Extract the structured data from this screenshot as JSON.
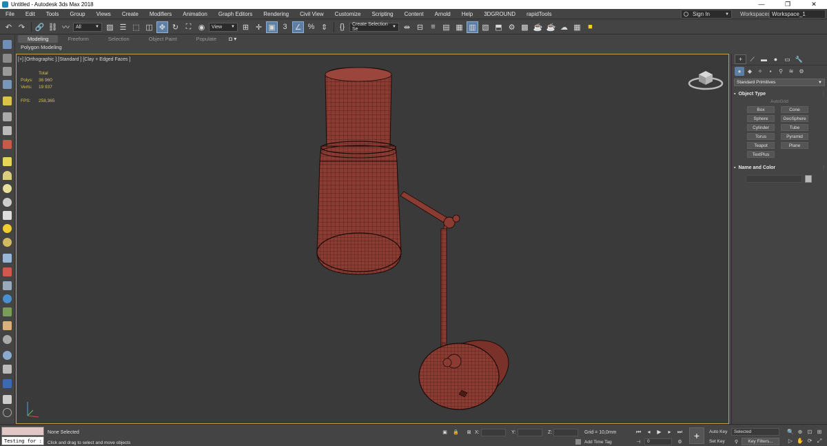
{
  "window": {
    "title": "Untitled - Autodesk 3ds Max 2018",
    "min": "—",
    "max": "❐",
    "close": "✕"
  },
  "menu": {
    "items": [
      "File",
      "Edit",
      "Tools",
      "Group",
      "Views",
      "Create",
      "Modifiers",
      "Animation",
      "Graph Editors",
      "Rendering",
      "Civil View",
      "Customize",
      "Scripting",
      "Content",
      "Arnold",
      "Help",
      "3DGROUND",
      "rapidTools"
    ],
    "sign_in": "Sign In",
    "workspaces_label": "Workspaces:",
    "workspace_value": "Workspace_1"
  },
  "toolbar": {
    "selection_filter": "All",
    "ref_coord": "View",
    "create_selection_set": "Create Selection Se"
  },
  "ribbon": {
    "tabs": [
      "Modeling",
      "Freeform",
      "Selection",
      "Object Paint",
      "Populate"
    ],
    "active_tab": "Modeling",
    "sub_label": "Polygon Modeling"
  },
  "viewport": {
    "label": "[+] [Orthographic ] [Standard ] [Clay + Edged Faces ]",
    "stats_header": "Total",
    "polys_label": "Polys:",
    "polys_value": "36 960",
    "verts_label": "Verts:",
    "verts_value": "19 937",
    "fps_label": "FPS:",
    "fps_value": "258,365",
    "wire_color": "#8a3b32",
    "edge_color": "#1f0e0c"
  },
  "command_panel": {
    "category": "Standard Primitives",
    "object_type_title": "Object Type",
    "autogrid": "AutoGrid",
    "buttons": [
      "Box",
      "Cone",
      "Sphere",
      "GeoSphere",
      "Cylinder",
      "Tube",
      "Torus",
      "Pyramid",
      "Teapot",
      "Plane",
      "TextPlus"
    ],
    "name_color_title": "Name and Color"
  },
  "status": {
    "maxscript_text": "Testing for :",
    "selection": "None Selected",
    "prompt": "Click and drag to select and move objects",
    "x_label": "X:",
    "y_label": "Y:",
    "z_label": "Z:",
    "grid": "Grid = 10,0mm",
    "add_time_tag": "Add Time Tag",
    "frame": "0",
    "auto_key": "Auto Key",
    "set_key": "Set Key",
    "selected": "Selected",
    "key_filters": "Key Filters..."
  }
}
